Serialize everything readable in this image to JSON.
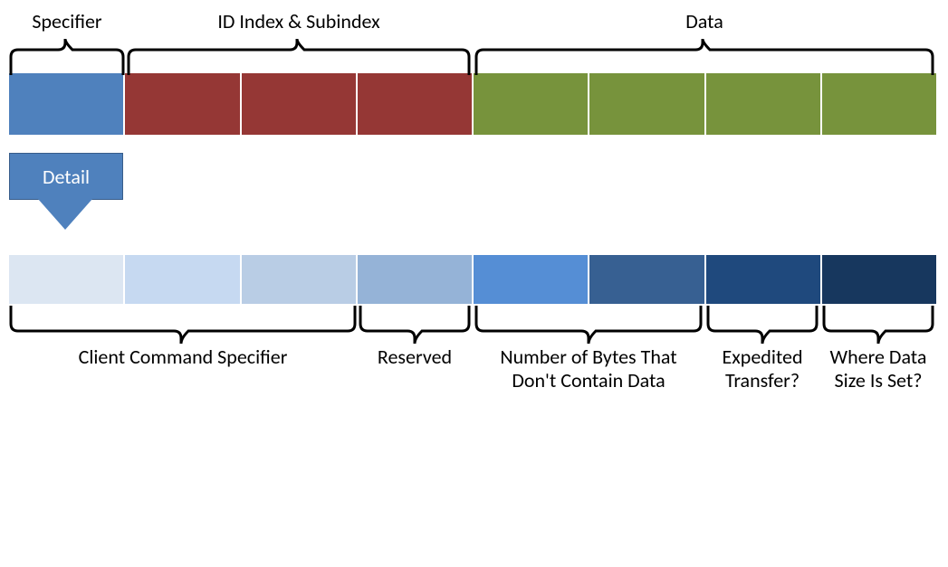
{
  "top_labels": {
    "specifier": "Specifier",
    "id_index": "ID Index & Subindex",
    "data": "Data"
  },
  "detail_label": "Detail",
  "bottom_labels": {
    "ccs": "Client Command Specifier",
    "reserved": "Reserved",
    "nbytes": "Number of Bytes That Don't Contain Data",
    "expedited": "Expedited Transfer?",
    "datasize": "Where Data Size Is Set?"
  },
  "chart_data": {
    "type": "table",
    "title": "SDO command byte layout",
    "upper_bytes": [
      {
        "index": 0,
        "field": "Specifier",
        "color": "blue"
      },
      {
        "index": 1,
        "field": "ID Index & Subindex",
        "color": "red"
      },
      {
        "index": 2,
        "field": "ID Index & Subindex",
        "color": "red"
      },
      {
        "index": 3,
        "field": "ID Index & Subindex",
        "color": "red"
      },
      {
        "index": 4,
        "field": "Data",
        "color": "green"
      },
      {
        "index": 5,
        "field": "Data",
        "color": "green"
      },
      {
        "index": 6,
        "field": "Data",
        "color": "green"
      },
      {
        "index": 7,
        "field": "Data",
        "color": "green"
      }
    ],
    "specifier_bits": [
      {
        "bit": 7,
        "field": "Client Command Specifier"
      },
      {
        "bit": 6,
        "field": "Client Command Specifier"
      },
      {
        "bit": 5,
        "field": "Client Command Specifier"
      },
      {
        "bit": 4,
        "field": "Reserved"
      },
      {
        "bit": 3,
        "field": "Number of Bytes That Don't Contain Data"
      },
      {
        "bit": 2,
        "field": "Number of Bytes That Don't Contain Data"
      },
      {
        "bit": 1,
        "field": "Expedited Transfer?"
      },
      {
        "bit": 0,
        "field": "Where Data Size Is Set?"
      }
    ]
  }
}
